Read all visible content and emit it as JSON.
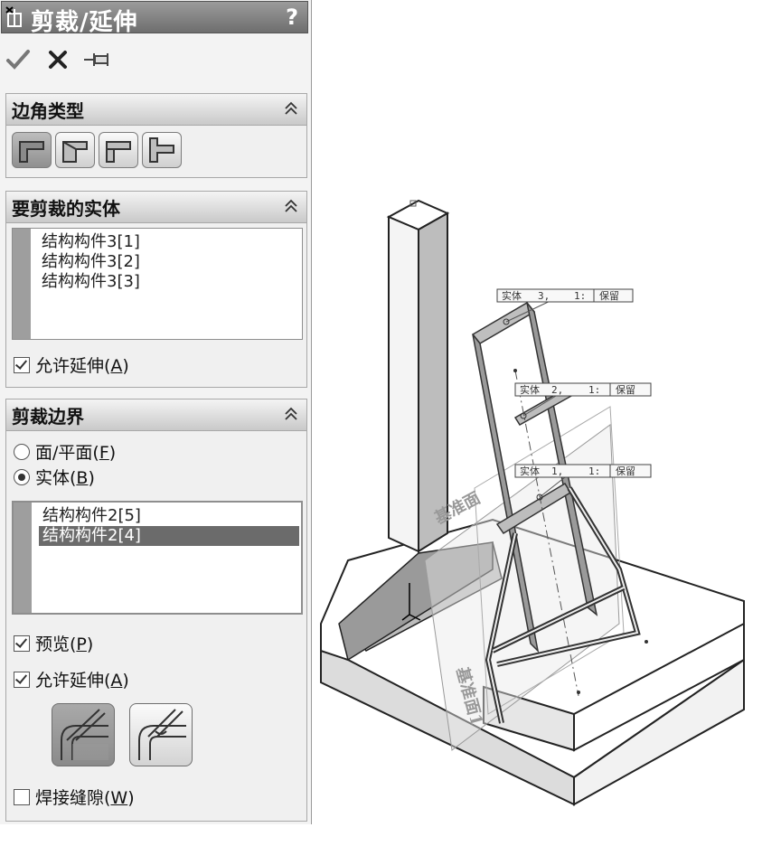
{
  "window": {
    "title": "剪裁/延伸",
    "help": "?"
  },
  "toolbar": {
    "ok_icon": "checkmark-icon",
    "cancel_icon": "x-icon",
    "pin_icon": "pushpin-icon"
  },
  "corner_type": {
    "title": "边角类型",
    "buttons": [
      "end-trim-icon",
      "end-miter-icon",
      "end-butt1-icon",
      "end-butt2-icon"
    ]
  },
  "bodies_to_trim": {
    "title": "要剪裁的实体",
    "items": [
      "结构构件3[1]",
      "结构构件3[2]",
      "结构构件3[3]"
    ],
    "allow_extend": {
      "label": "允许延伸(",
      "mnemonic": "A",
      "close": ")",
      "checked": true
    }
  },
  "trim_boundary": {
    "title": "剪裁边界",
    "radio_face": {
      "label": "面/平面(",
      "mnemonic": "F",
      "close": ")",
      "selected": false
    },
    "radio_body": {
      "label": "实体(",
      "mnemonic": "B",
      "close": ")",
      "selected": true
    },
    "items": [
      "结构构件2[5]",
      "结构构件2[4]"
    ],
    "preview": {
      "label": "预览(",
      "mnemonic": "P",
      "close": ")",
      "checked": true
    },
    "allow_extend": {
      "label": "允许延伸(",
      "mnemonic": "A",
      "close": ")",
      "checked": true
    },
    "weld_gap": {
      "label": "焊接缝隙(",
      "mnemonic": "W",
      "close": ")",
      "checked": false
    }
  },
  "viewport": {
    "callouts": [
      {
        "body": "实体",
        "num": "3,",
        "idx": "1:",
        "action": "保留"
      },
      {
        "body": "实体",
        "num": "2,",
        "idx": "1:",
        "action": "保留"
      },
      {
        "body": "实体",
        "num": "1,",
        "idx": "1:",
        "action": "保留"
      }
    ],
    "plane_label_upper": "基准面",
    "plane_label_lower": "基准面1"
  }
}
